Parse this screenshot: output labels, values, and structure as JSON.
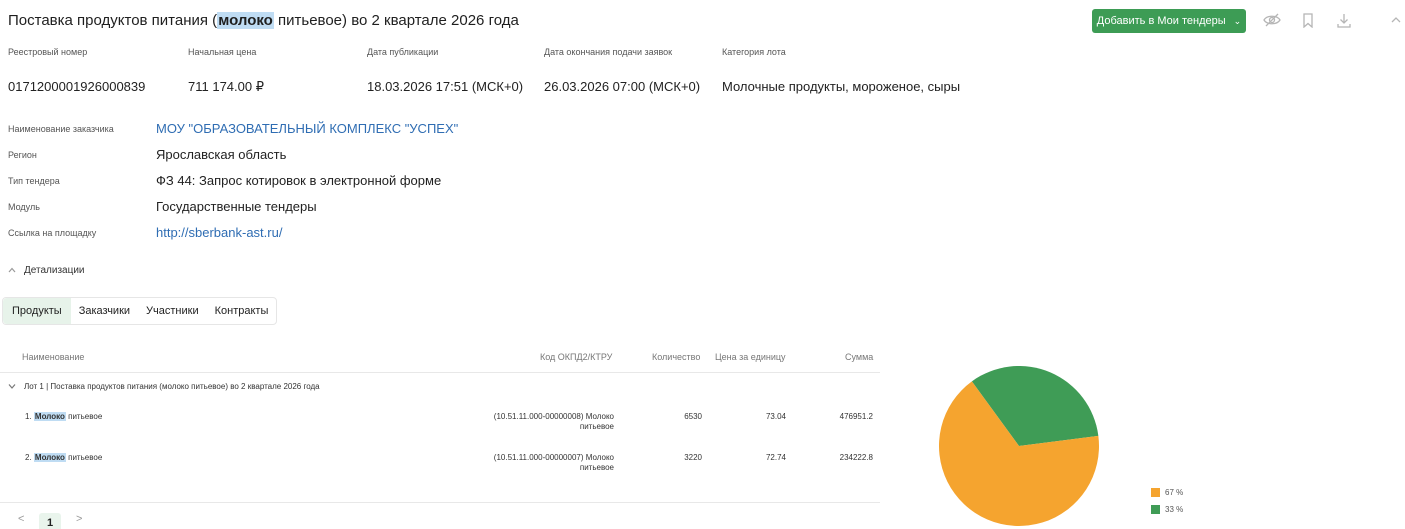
{
  "header": {
    "title_before": "Поставка продуктов питания (",
    "title_highlight": "молоко",
    "title_after": " питьевое) во 2 квартале 2026 года",
    "add_button_label": "Добавить в Мои тендеры"
  },
  "info": {
    "registry_label": "Реестровый номер",
    "registry_value": "0171200001926000839",
    "price_label": "Начальная цена",
    "price_value": "711 174.00 ₽",
    "pub_label": "Дата публикации",
    "pub_value": "18.03.2026 17:51 (МСК+0)",
    "end_label": "Дата окончания подачи заявок",
    "end_value": "26.03.2026 07:00 (МСК+0)",
    "category_label": "Категория лота",
    "category_value": "Молочные продукты, мороженое, сыры"
  },
  "details": {
    "customer_label": "Наименование заказчика",
    "customer_value": "МОУ \"ОБРАЗОВАТЕЛЬНЫЙ КОМПЛЕКС \"УСПЕХ\"",
    "region_label": "Регион",
    "region_value": "Ярославская область",
    "type_label": "Тип тендера",
    "type_value": "ФЗ 44: Запрос котировок в электронной форме",
    "module_label": "Модуль",
    "module_value": "Государственные тендеры",
    "site_label": "Ссылка на площадку",
    "site_value": "http://sberbank-ast.ru/"
  },
  "detail_toggle_label": "Детализации",
  "tabs": [
    {
      "label": "Продукты"
    },
    {
      "label": "Заказчики"
    },
    {
      "label": "Участники"
    },
    {
      "label": "Контракты"
    }
  ],
  "table": {
    "headers": {
      "name": "Наименование",
      "code": "Код ОКПД2/КТРУ",
      "qty": "Количество",
      "unit_price": "Цена за единицу",
      "sum": "Сумма"
    },
    "lot_label": "Лот 1 | Поставка продуктов питания (молоко питьевое) во 2 квартале 2026 года",
    "rows": [
      {
        "prefix": "1. ",
        "highlight": "Молоко",
        "suffix": " питьевое",
        "code_line1": "(10.51.11.000-00000008) Молоко",
        "code_line2": "питьевое",
        "qty": "6530",
        "unit_price": "73.04",
        "sum": "476951.2"
      },
      {
        "prefix": "2. ",
        "highlight": "Молоко",
        "suffix": " питьевое",
        "code_line1": "(10.51.11.000-00000007) Молоко",
        "code_line2": "питьевое",
        "qty": "3220",
        "unit_price": "72.74",
        "sum": "234222.8"
      }
    ]
  },
  "pagination": {
    "current_page": "1",
    "prev_glyph": "<",
    "next_glyph": ">"
  },
  "pie": {
    "slices": [
      {
        "value": 67,
        "color": "#f5a42f"
      },
      {
        "value": 33,
        "color": "#3f9c56"
      }
    ],
    "legend": [
      {
        "label": "67 %",
        "color": "#f5a42f"
      },
      {
        "label": "33 %",
        "color": "#3f9c56"
      }
    ]
  },
  "colors": {
    "accent_green": "#3d9c55",
    "link_blue": "#2f6db3",
    "highlight_blue": "#bfdcf3"
  },
  "icons": {
    "hide": "eye-off-icon",
    "bookmark": "bookmark-icon",
    "download": "download-icon",
    "collapse": "chevron-up-icon"
  }
}
